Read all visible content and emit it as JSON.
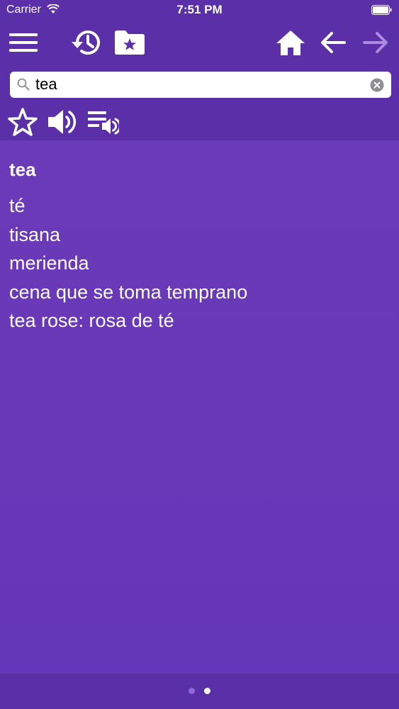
{
  "status_bar": {
    "carrier": "Carrier",
    "time": "7:51 PM"
  },
  "toolbar": {
    "icons": [
      "menu-icon",
      "history-icon",
      "favorites-folder-icon",
      "home-icon",
      "back-arrow-icon",
      "forward-arrow-icon"
    ],
    "forward_enabled": false
  },
  "search": {
    "value": "tea",
    "placeholder": ""
  },
  "actions": {
    "icons": [
      "star-icon",
      "speaker-icon",
      "playlist-audio-icon"
    ]
  },
  "entry": {
    "headword": "tea",
    "translations": [
      "té",
      "tisana",
      "merienda",
      "cena que se toma temprano",
      "tea rose: rosa de té"
    ]
  },
  "pager": {
    "pages": 2,
    "current": 2
  },
  "colors": {
    "bar_background": "#5a2fa8",
    "content_background": "#6838b8",
    "text": "#ffffff",
    "disabled_icon": "#a98ce0"
  }
}
